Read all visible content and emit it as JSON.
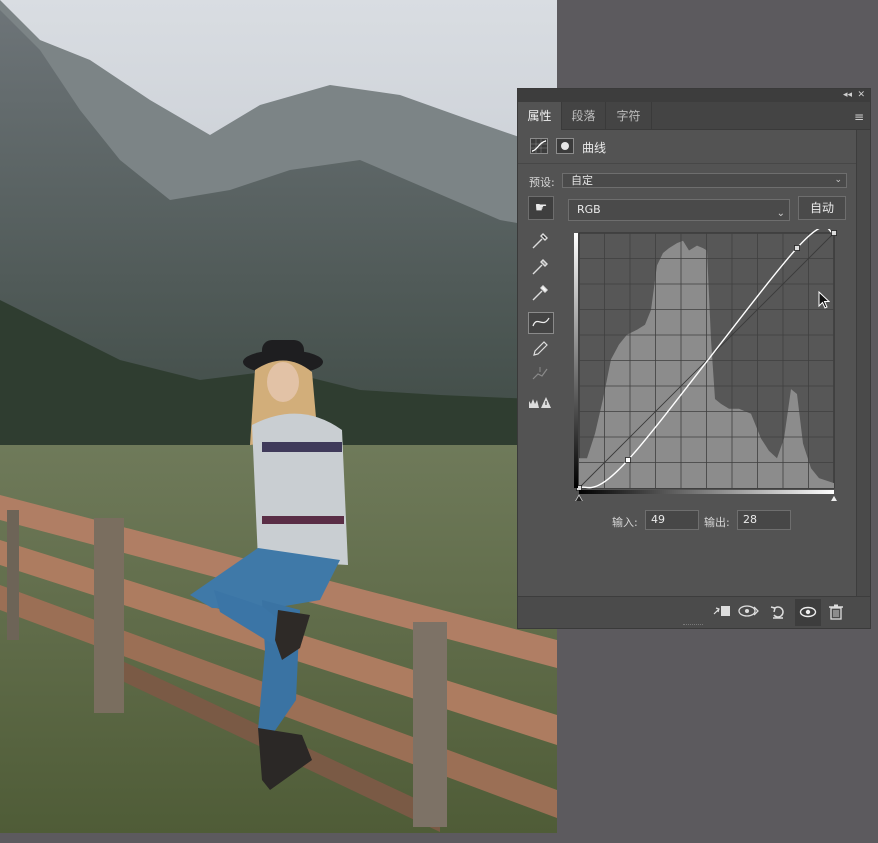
{
  "panel": {
    "tabs": [
      {
        "label": "属性",
        "active": true
      },
      {
        "label": "段落",
        "active": false
      },
      {
        "label": "字符",
        "active": false
      }
    ],
    "collapse_glyph": "◂◂",
    "close_glyph": "✕",
    "menu_glyph": "≡",
    "adjustment_title": "曲线",
    "preset_label": "预设:",
    "preset_value": "自定",
    "channel_value": "RGB",
    "auto_label": "自动",
    "input_label": "输入:",
    "input_value": "49",
    "output_label": "输出:",
    "output_value": "28"
  },
  "curve": {
    "points": [
      [
        0,
        0
      ],
      [
        49,
        28
      ],
      [
        218,
        240
      ],
      [
        255,
        255
      ]
    ],
    "range": [
      0,
      255
    ]
  },
  "icons": {
    "curves_adjustment": "curves-adjustment-icon",
    "mask": "layer-mask-icon",
    "target_adjustment": "hand-target-icon",
    "eyedroppers": [
      "black-eyedropper-icon",
      "gray-eyedropper-icon",
      "white-eyedropper-icon"
    ],
    "tools": [
      "curve-point-icon",
      "pencil-icon",
      "smooth-icon",
      "clipping-warning-icon"
    ],
    "bottom": [
      "clip-to-layer-icon",
      "view-previous-icon",
      "reset-icon",
      "eye-icon",
      "trash-icon"
    ]
  },
  "colors": {
    "panel_bg": "#535353",
    "graph_bg": "#575757",
    "histogram": "#8c8c8c",
    "curve": "#ffffff"
  }
}
